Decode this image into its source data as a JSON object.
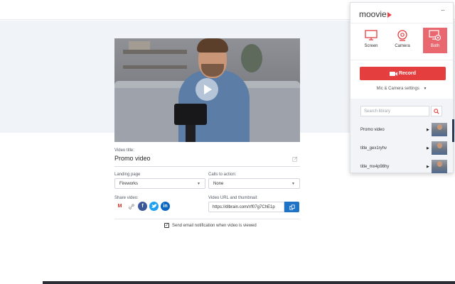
{
  "page": {
    "video_title_label": "Video title:",
    "video_title": "Promo video",
    "landing_page_label": "Landing page",
    "landing_page_value": "Fireworks",
    "cta_label": "Calls to action:",
    "cta_value": "None",
    "share_label": "Share video:",
    "url_label": "Video URL and thumbnail:",
    "url_value": "https://dlbrain.com/r/f07g7ChE1p",
    "notify_label": "Send email notification when video is viewed",
    "notify_checked": true,
    "share_icons": [
      "gmail-icon",
      "link-icon",
      "facebook-icon",
      "twitter-icon",
      "linkedin-icon"
    ]
  },
  "popup": {
    "logo": "moovie",
    "menu": "···",
    "modes": [
      {
        "label": "Screen",
        "icon": "monitor-icon",
        "active": false
      },
      {
        "label": "Camera",
        "icon": "webcam-icon",
        "active": false
      },
      {
        "label": "Both",
        "icon": "screen-and-camera-icon",
        "active": true
      }
    ],
    "record_label": "Record",
    "settings_label": "Mic & Camera settings",
    "search_placeholder": "Search library",
    "library": [
      {
        "name": "Promo video"
      },
      {
        "name": "title_gex1ryhv"
      },
      {
        "name": "title_mx4p98hy"
      }
    ]
  },
  "colors": {
    "accent_red": "#e53e3e",
    "active_mode": "#e96870",
    "copy_button": "#1f73c7",
    "band": "#f0f3f7"
  }
}
